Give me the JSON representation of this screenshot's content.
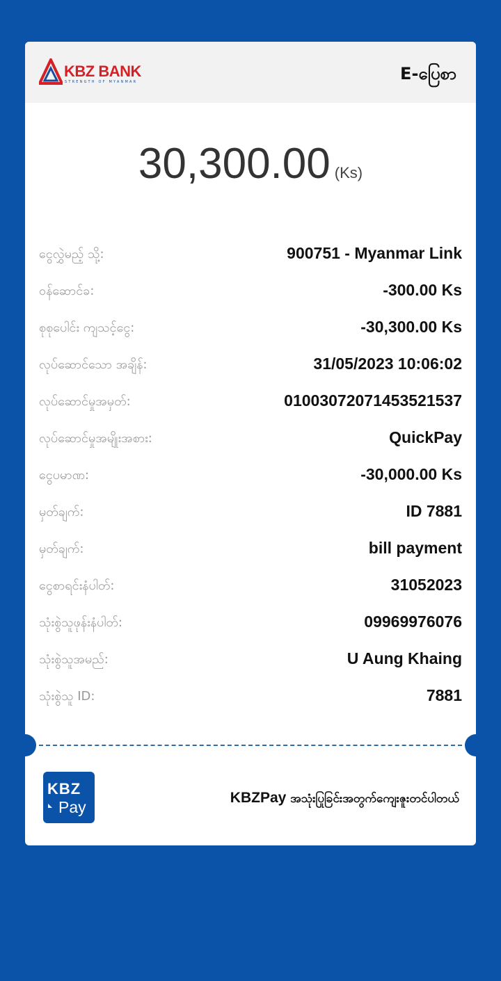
{
  "header": {
    "logo_text": "KBZ BANK",
    "logo_tagline": "STRENGTH OF MYANMAR",
    "receipt_title": "E-ပြေစာ"
  },
  "amount": {
    "value": "30,300.00",
    "currency": "(Ks)"
  },
  "details": [
    {
      "label": "ငွေလွှဲမည့် သို့:",
      "value": "900751 - Myanmar Link"
    },
    {
      "label": "ဝန်ဆောင်ခ:",
      "value": "-300.00 Ks"
    },
    {
      "label": "စုစုပေါင်း ကျသင့်ငွေ:",
      "value": "-30,300.00 Ks"
    },
    {
      "label": "လုပ်ဆောင်သော အချိန်:",
      "value": "31/05/2023 10:06:02"
    },
    {
      "label": "လုပ်ဆောင်မှုအမှတ်:",
      "value": "01003072071453521537"
    },
    {
      "label": "လုပ်ဆောင်မှုအမျိုးအစား:",
      "value": "QuickPay"
    },
    {
      "label": "ငွေပမာဏ:",
      "value": "-30,000.00 Ks"
    },
    {
      "label": "မှတ်ချက်:",
      "value": "ID 7881"
    },
    {
      "label": "မှတ်ချက်:",
      "value": "bill payment"
    },
    {
      "label": "ငွေစာရင်းနံပါတ်:",
      "value": "31052023"
    },
    {
      "label": "သုံးစွဲသူဖုန်းနံပါတ်:",
      "value": "09969976076"
    },
    {
      "label": "သုံးစွဲသူအမည်:",
      "value": "U Aung Khaing"
    },
    {
      "label": "သုံးစွဲသူ ID:",
      "value": "7881"
    }
  ],
  "footer": {
    "kbzpay_logo_top": "KBZ",
    "kbzpay_logo_bottom": "Pay",
    "brand": "KBZPay",
    "message": "အသုံးပြုခြင်းအတွက်ကျေးဇူးတင်ပါတယ်"
  },
  "colors": {
    "background": "#0a53a8",
    "logo_red": "#d42027",
    "logo_blue": "#1a4c9c"
  }
}
